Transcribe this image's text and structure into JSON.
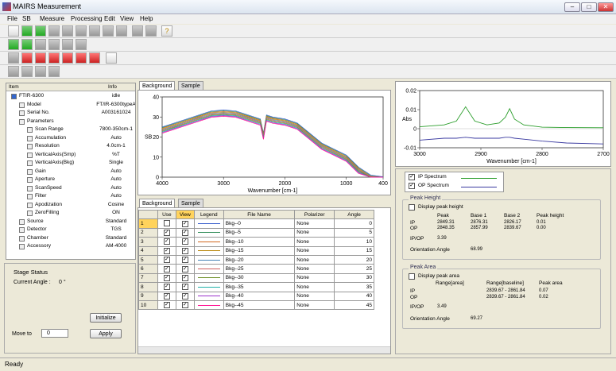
{
  "app": {
    "title": "MAIRS Measurement"
  },
  "menu": [
    "File",
    "SB",
    "Measure",
    "Processing",
    "Edit",
    "View",
    "Help"
  ],
  "tree": {
    "headers": [
      "Item",
      "Info"
    ],
    "rows": [
      {
        "name": "FTIR-6300",
        "value": "idle",
        "indent": 0
      },
      {
        "name": "Model",
        "value": "FT/IR-6300typeA",
        "indent": 1
      },
      {
        "name": "Serial No.",
        "value": "A003161024",
        "indent": 1
      },
      {
        "name": "Parameters",
        "value": "",
        "indent": 1
      },
      {
        "name": "Scan Range",
        "value": "7800-350cm-1",
        "indent": 2
      },
      {
        "name": "Accumulation",
        "value": "Auto",
        "indent": 2
      },
      {
        "name": "Resolution",
        "value": "4.0cm-1",
        "indent": 2
      },
      {
        "name": "VerticalAxis(Smp)",
        "value": "%T",
        "indent": 2
      },
      {
        "name": "VerticalAxis(Bkg)",
        "value": "Single",
        "indent": 2
      },
      {
        "name": "Gain",
        "value": "Auto",
        "indent": 2
      },
      {
        "name": "Aperture",
        "value": "Auto",
        "indent": 2
      },
      {
        "name": "ScanSpeed",
        "value": "Auto",
        "indent": 2
      },
      {
        "name": "Filter",
        "value": "Auto",
        "indent": 2
      },
      {
        "name": "Apodization",
        "value": "Cosine",
        "indent": 2
      },
      {
        "name": "ZeroFilling",
        "value": "ON",
        "indent": 2
      },
      {
        "name": "Source",
        "value": "Standard",
        "indent": 1
      },
      {
        "name": "Detector",
        "value": "TGS",
        "indent": 1
      },
      {
        "name": "Chamber",
        "value": "Standard",
        "indent": 1
      },
      {
        "name": "Accessory",
        "value": "AM-4000",
        "indent": 1
      }
    ]
  },
  "stage": {
    "title": "Stage Status",
    "current_label": "Current Angle :",
    "current_value": "0 °",
    "initialize": "Initialize",
    "moveto_label": "Move to",
    "moveto_value": "0",
    "apply": "Apply"
  },
  "spectrum_tabs": [
    "Background",
    "Sample"
  ],
  "table_tabs": [
    "Background",
    "Sample"
  ],
  "chart_data": [
    {
      "type": "line",
      "title": "",
      "xlabel": "Wavenumber [cm-1]",
      "ylabel": "SB",
      "xlim": [
        4000,
        400
      ],
      "ylim": [
        0,
        40
      ],
      "xticks": [
        "4000",
        "3000",
        "2000",
        "1000",
        "400"
      ],
      "yticks": [
        "40",
        "30",
        "20",
        "10",
        "0"
      ],
      "x": [
        4000,
        3800,
        3600,
        3400,
        3200,
        3000,
        2800,
        2600,
        2400,
        2350,
        2300,
        2200,
        2000,
        1800,
        1600,
        1400,
        1200,
        1000,
        800,
        600,
        400
      ],
      "series": [
        {
          "values": [
            25,
            27,
            29,
            31,
            33,
            33.5,
            33,
            31,
            29,
            22,
            31,
            30,
            29,
            27,
            22,
            17,
            14,
            11,
            5,
            1,
            0.2
          ]
        }
      ]
    },
    {
      "type": "line",
      "title": "",
      "xlabel": "Wavenumber [cm-1]",
      "ylabel": "Abs",
      "xlim": [
        3000,
        2700
      ],
      "ylim": [
        -0.01,
        0.02
      ],
      "xticks": [
        "3000",
        "2900",
        "2800",
        "2700"
      ],
      "yticks": [
        "0.02",
        "0.01",
        "0",
        "-0.01"
      ],
      "x": [
        3000,
        2960,
        2940,
        2925,
        2910,
        2890,
        2870,
        2860,
        2853,
        2845,
        2830,
        2800,
        2760,
        2700
      ],
      "series": [
        {
          "name": "IP Spectrum",
          "color": "#2a9d2a",
          "values": [
            0.001,
            0.002,
            0.004,
            0.0115,
            0.004,
            0.002,
            0.003,
            0.006,
            0.0105,
            0.005,
            0.002,
            0.0008,
            0.0006,
            0.0005
          ]
        },
        {
          "name": "OP Spectrum",
          "color": "#3a3aa0",
          "values": [
            -0.006,
            -0.005,
            -0.005,
            -0.0045,
            -0.005,
            -0.005,
            -0.005,
            -0.0045,
            -0.0045,
            -0.005,
            -0.0055,
            -0.0065,
            -0.0075,
            -0.008
          ]
        }
      ]
    }
  ],
  "grid": {
    "headers": [
      "",
      "Use",
      "View",
      "Legend",
      "File Name",
      "Polarizer",
      "Angle"
    ],
    "rows": [
      {
        "n": "1",
        "use": false,
        "view": true,
        "color": "#3a5fcd",
        "file": "Bkg--0",
        "pol": "None",
        "angle": "0"
      },
      {
        "n": "2",
        "use": true,
        "view": true,
        "color": "#2e8b57",
        "file": "Bkg--5",
        "pol": "None",
        "angle": "5"
      },
      {
        "n": "3",
        "use": true,
        "view": true,
        "color": "#d2691e",
        "file": "Bkg--10",
        "pol": "None",
        "angle": "10"
      },
      {
        "n": "4",
        "use": true,
        "view": true,
        "color": "#b8860b",
        "file": "Bkg--15",
        "pol": "None",
        "angle": "15"
      },
      {
        "n": "5",
        "use": true,
        "view": true,
        "color": "#4682b4",
        "file": "Bkg--20",
        "pol": "None",
        "angle": "20"
      },
      {
        "n": "6",
        "use": true,
        "view": true,
        "color": "#cd5c5c",
        "file": "Bkg--25",
        "pol": "None",
        "angle": "25"
      },
      {
        "n": "7",
        "use": true,
        "view": true,
        "color": "#6b8e23",
        "file": "Bkg--30",
        "pol": "None",
        "angle": "30"
      },
      {
        "n": "8",
        "use": true,
        "view": true,
        "color": "#20b2aa",
        "file": "Bkg--35",
        "pol": "None",
        "angle": "35"
      },
      {
        "n": "9",
        "use": true,
        "view": true,
        "color": "#9932cc",
        "file": "Bkg--40",
        "pol": "None",
        "angle": "40"
      },
      {
        "n": "10",
        "use": true,
        "view": true,
        "color": "#ff1493",
        "file": "Bkg--45",
        "pol": "None",
        "angle": "45"
      }
    ]
  },
  "legend": {
    "ip": "IP Spectrum",
    "op": "OP Spectrum"
  },
  "peak_height": {
    "title": "Peak Height",
    "display": "Display peak height",
    "h_peak": "Peak",
    "h_base1": "Base 1",
    "h_base2": "Base 2",
    "h_height": "Peak height",
    "ip_label": "IP",
    "ip_peak": "2849.31",
    "ip_base1": "2876.31",
    "ip_base2": "2826.17",
    "ip_height": "0.01",
    "op_label": "OP",
    "op_peak": "2848.35",
    "op_base1": "2857.99",
    "op_base2": "2839.67",
    "op_height": "0.00",
    "ipop_label": "IP/OP",
    "ipop_value": "3.39",
    "orient_label": "Orientation Angle",
    "orient_value": "68.99"
  },
  "peak_area": {
    "title": "Peak Area",
    "display": "Display peak area",
    "h_range": "Range[area]",
    "h_baseline": "Range[baseline]",
    "h_area": "Peak area",
    "ip_label": "IP",
    "ip_baseline": "2839.67 - 2861.84",
    "ip_area": "0.07",
    "op_label": "OP",
    "op_baseline": "2839.67 - 2861.84",
    "op_area": "0.02",
    "ipop_label": "IP/OP",
    "ipop_value": "3.49",
    "orient_label": "Orientation Angle",
    "orient_value": "69.27"
  },
  "status": "Ready"
}
